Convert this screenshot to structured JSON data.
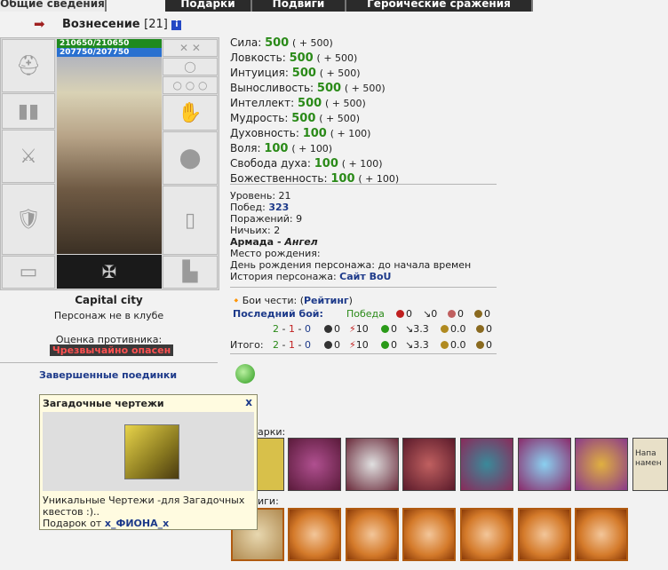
{
  "tabs": [
    "Общие сведения",
    "Подарки",
    "Подвиги",
    "Героические сражения"
  ],
  "character": {
    "name": "Вознесение",
    "level": "[21]",
    "info_icon": "i",
    "hp": "210650/210650",
    "mp": "207750/207750"
  },
  "location": {
    "city": "Capital city",
    "club": "Персонаж не в клубе"
  },
  "evaluation": {
    "label": "Оценка противника:",
    "value": "Чрезвычайно опасен"
  },
  "fights_link": "Завершенные поединки",
  "stats": [
    {
      "name": "Сила:",
      "value": "500",
      "bonus": "( + 500)"
    },
    {
      "name": "Ловкость:",
      "value": "500",
      "bonus": "( + 500)"
    },
    {
      "name": "Интуиция:",
      "value": "500",
      "bonus": "( + 500)"
    },
    {
      "name": "Выносливость:",
      "value": "500",
      "bonus": "( + 500)"
    },
    {
      "name": "Интеллект:",
      "value": "500",
      "bonus": "( + 500)"
    },
    {
      "name": "Мудрость:",
      "value": "500",
      "bonus": "( + 500)"
    },
    {
      "name": "Духовность:",
      "value": "100",
      "bonus": "( + 100)"
    },
    {
      "name": "Воля:",
      "value": "100",
      "bonus": "( + 100)"
    },
    {
      "name": "Свобода духа:",
      "value": "100",
      "bonus": "( + 100)"
    },
    {
      "name": "Божественность:",
      "value": "100",
      "bonus": "( + 100)"
    }
  ],
  "info": {
    "level": "Уровень: 21",
    "wins_label": "Побед: ",
    "wins": "323",
    "losses": "Поражений: 9",
    "draws": "Ничьих: 2",
    "armada_label": "Армада - ",
    "armada_rank": "Ангел",
    "birthplace": "Место рождения:",
    "birthday": "День рождения персонажа: до начала времен",
    "history_label": "История персонажа: ",
    "history_link": "Сайт BoU"
  },
  "honor": {
    "label": "Бои чести: (",
    "link": "Рейтинг",
    "end": ")"
  },
  "last_fight": {
    "label": "Последний бой:",
    "result": "Победа",
    "v1": "0",
    "v2": "0",
    "v3": "0",
    "v4": "0"
  },
  "row1": {
    "w": "2",
    "sep1": " - ",
    "l": "1",
    "sep2": " - ",
    "d": "0",
    "a": "0",
    "b": "10",
    "c": "0",
    "e": "3.3",
    "f": "0.0",
    "g": "0"
  },
  "total": {
    "label": "Итого:",
    "w": "2",
    "sep1": " - ",
    "l": "1",
    "sep2": " - ",
    "d": "0",
    "a": "0",
    "b": "10",
    "c": "0",
    "e": "3.3",
    "f": "0.0",
    "g": "0"
  },
  "popup": {
    "title": "Загадочные чертежи",
    "close": "x",
    "desc": "Уникальные Чертежи -для Загадочных квестов :)..",
    "from_label": "Подарок от ",
    "from_name": "x_ФИОНА_x"
  },
  "gifts_label": "арки:",
  "deeds_label": "иги:",
  "gift_colors": [
    "#d8c04a",
    "#7a2a5a",
    "#c8c8c8",
    "#8a2a2a",
    "#a04070",
    "#8a2a6a",
    "#c03070",
    "#8a6a9a"
  ],
  "gift_last_text": "Напа\nнамен",
  "colors": {
    "green": "#2a8a18",
    "blue": "#1d3a8a",
    "danger": "#ff5050"
  }
}
